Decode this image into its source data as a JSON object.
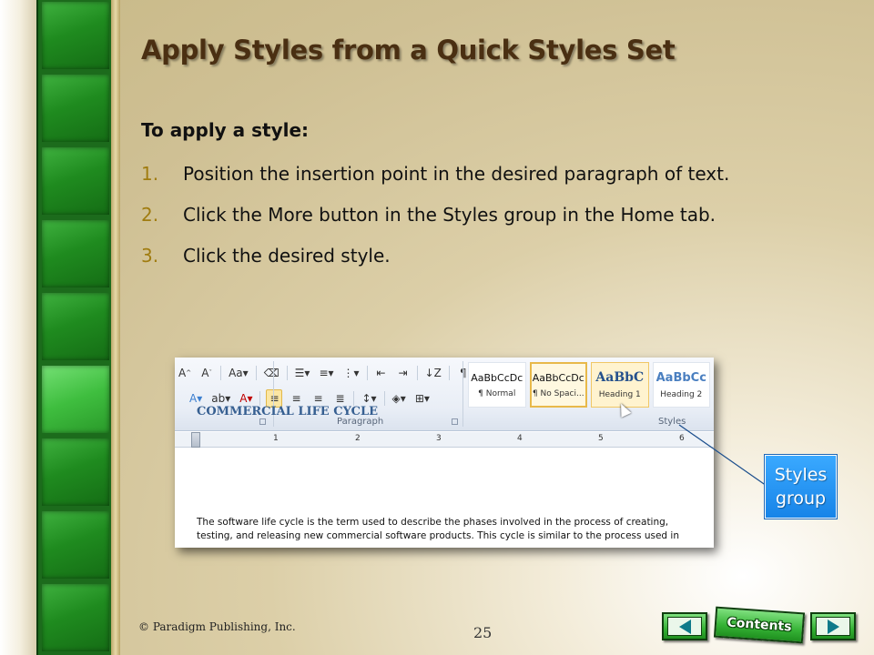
{
  "slide": {
    "title": "Apply Styles from a Quick Styles Set",
    "subheading": "To apply a style:",
    "steps": [
      {
        "num": "1.",
        "text": "Position the insertion point in the desired paragraph of text."
      },
      {
        "num": "2.",
        "text": "Click the More button in the Styles group in the Home tab."
      },
      {
        "num": "3.",
        "text": "Click the desired style."
      }
    ]
  },
  "screenshot": {
    "ribbon": {
      "paragraph_group_label": "Paragraph",
      "styles_group_label": "Styles",
      "style_tiles": [
        {
          "sample": "AaBbCcDc",
          "name": "¶ Normal",
          "state": "normal"
        },
        {
          "sample": "AaBbCcDc",
          "name": "¶ No Spaci...",
          "state": "selected"
        },
        {
          "sample": "AaBbC",
          "name": "Heading 1",
          "state": "hover"
        },
        {
          "sample": "AaBbCc",
          "name": "Heading 2",
          "state": "normal"
        }
      ]
    },
    "ruler_numbers": [
      "1",
      "2",
      "3",
      "4",
      "5",
      "6"
    ],
    "document": {
      "heading": "COMMERCIAL LIFE CYCLE",
      "body": "The software life cycle is the term used to describe the phases involved in the process of creating, testing, and releasing new commercial software products. This cycle is similar to the process used in"
    }
  },
  "callout": {
    "line1": "Styles",
    "line2": "group"
  },
  "footer": {
    "copyright": "© Paradigm Publishing, Inc.",
    "page_number": "25",
    "contents_label": "Contents"
  },
  "colors": {
    "title": "#4a2f12",
    "step_number": "#a07c10",
    "callout_fill": "#1784e8",
    "nav_green": "#35b235"
  }
}
